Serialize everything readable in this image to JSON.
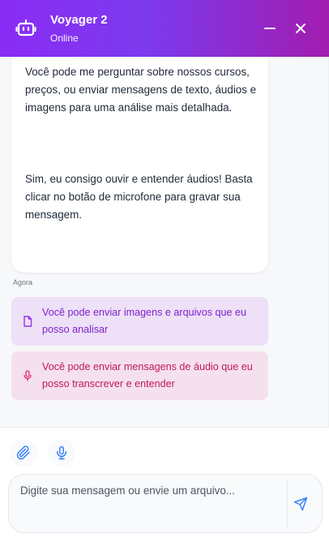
{
  "header": {
    "title": "Voyager 2",
    "status": "Online",
    "avatar_icon": "robot-icon",
    "minimize_icon": "minus-icon",
    "close_icon": "close-icon",
    "gradient_start": "#8b2cf5",
    "gradient_end": "#a21caf"
  },
  "messages": {
    "bot_message": {
      "paragraph_1": "Você pode me perguntar sobre nossos cursos, preços, ou enviar mensagens de texto, áudios e imagens para uma análise mais detalhada.",
      "paragraph_2": "Sim, eu consigo ouvir e entender áudios! Basta clicar no botão de microfone para gravar sua mensagem.",
      "timestamp": "Agora"
    },
    "hints": [
      {
        "icon": "file-icon",
        "text": "Você pode enviar imagens e arquivos que eu posso analisar",
        "color": "#7e22ce"
      },
      {
        "icon": "microphone-icon",
        "text": "Você pode enviar mensagens de áudio que eu posso transcrever e entender",
        "color": "#be185d"
      }
    ]
  },
  "composer": {
    "attach_icon": "paperclip-icon",
    "mic_icon": "microphone-icon",
    "placeholder": "Digite sua mensagem ou envie um arquivo...",
    "value": "",
    "send_icon": "send-icon",
    "accent": "#3b82f6"
  }
}
